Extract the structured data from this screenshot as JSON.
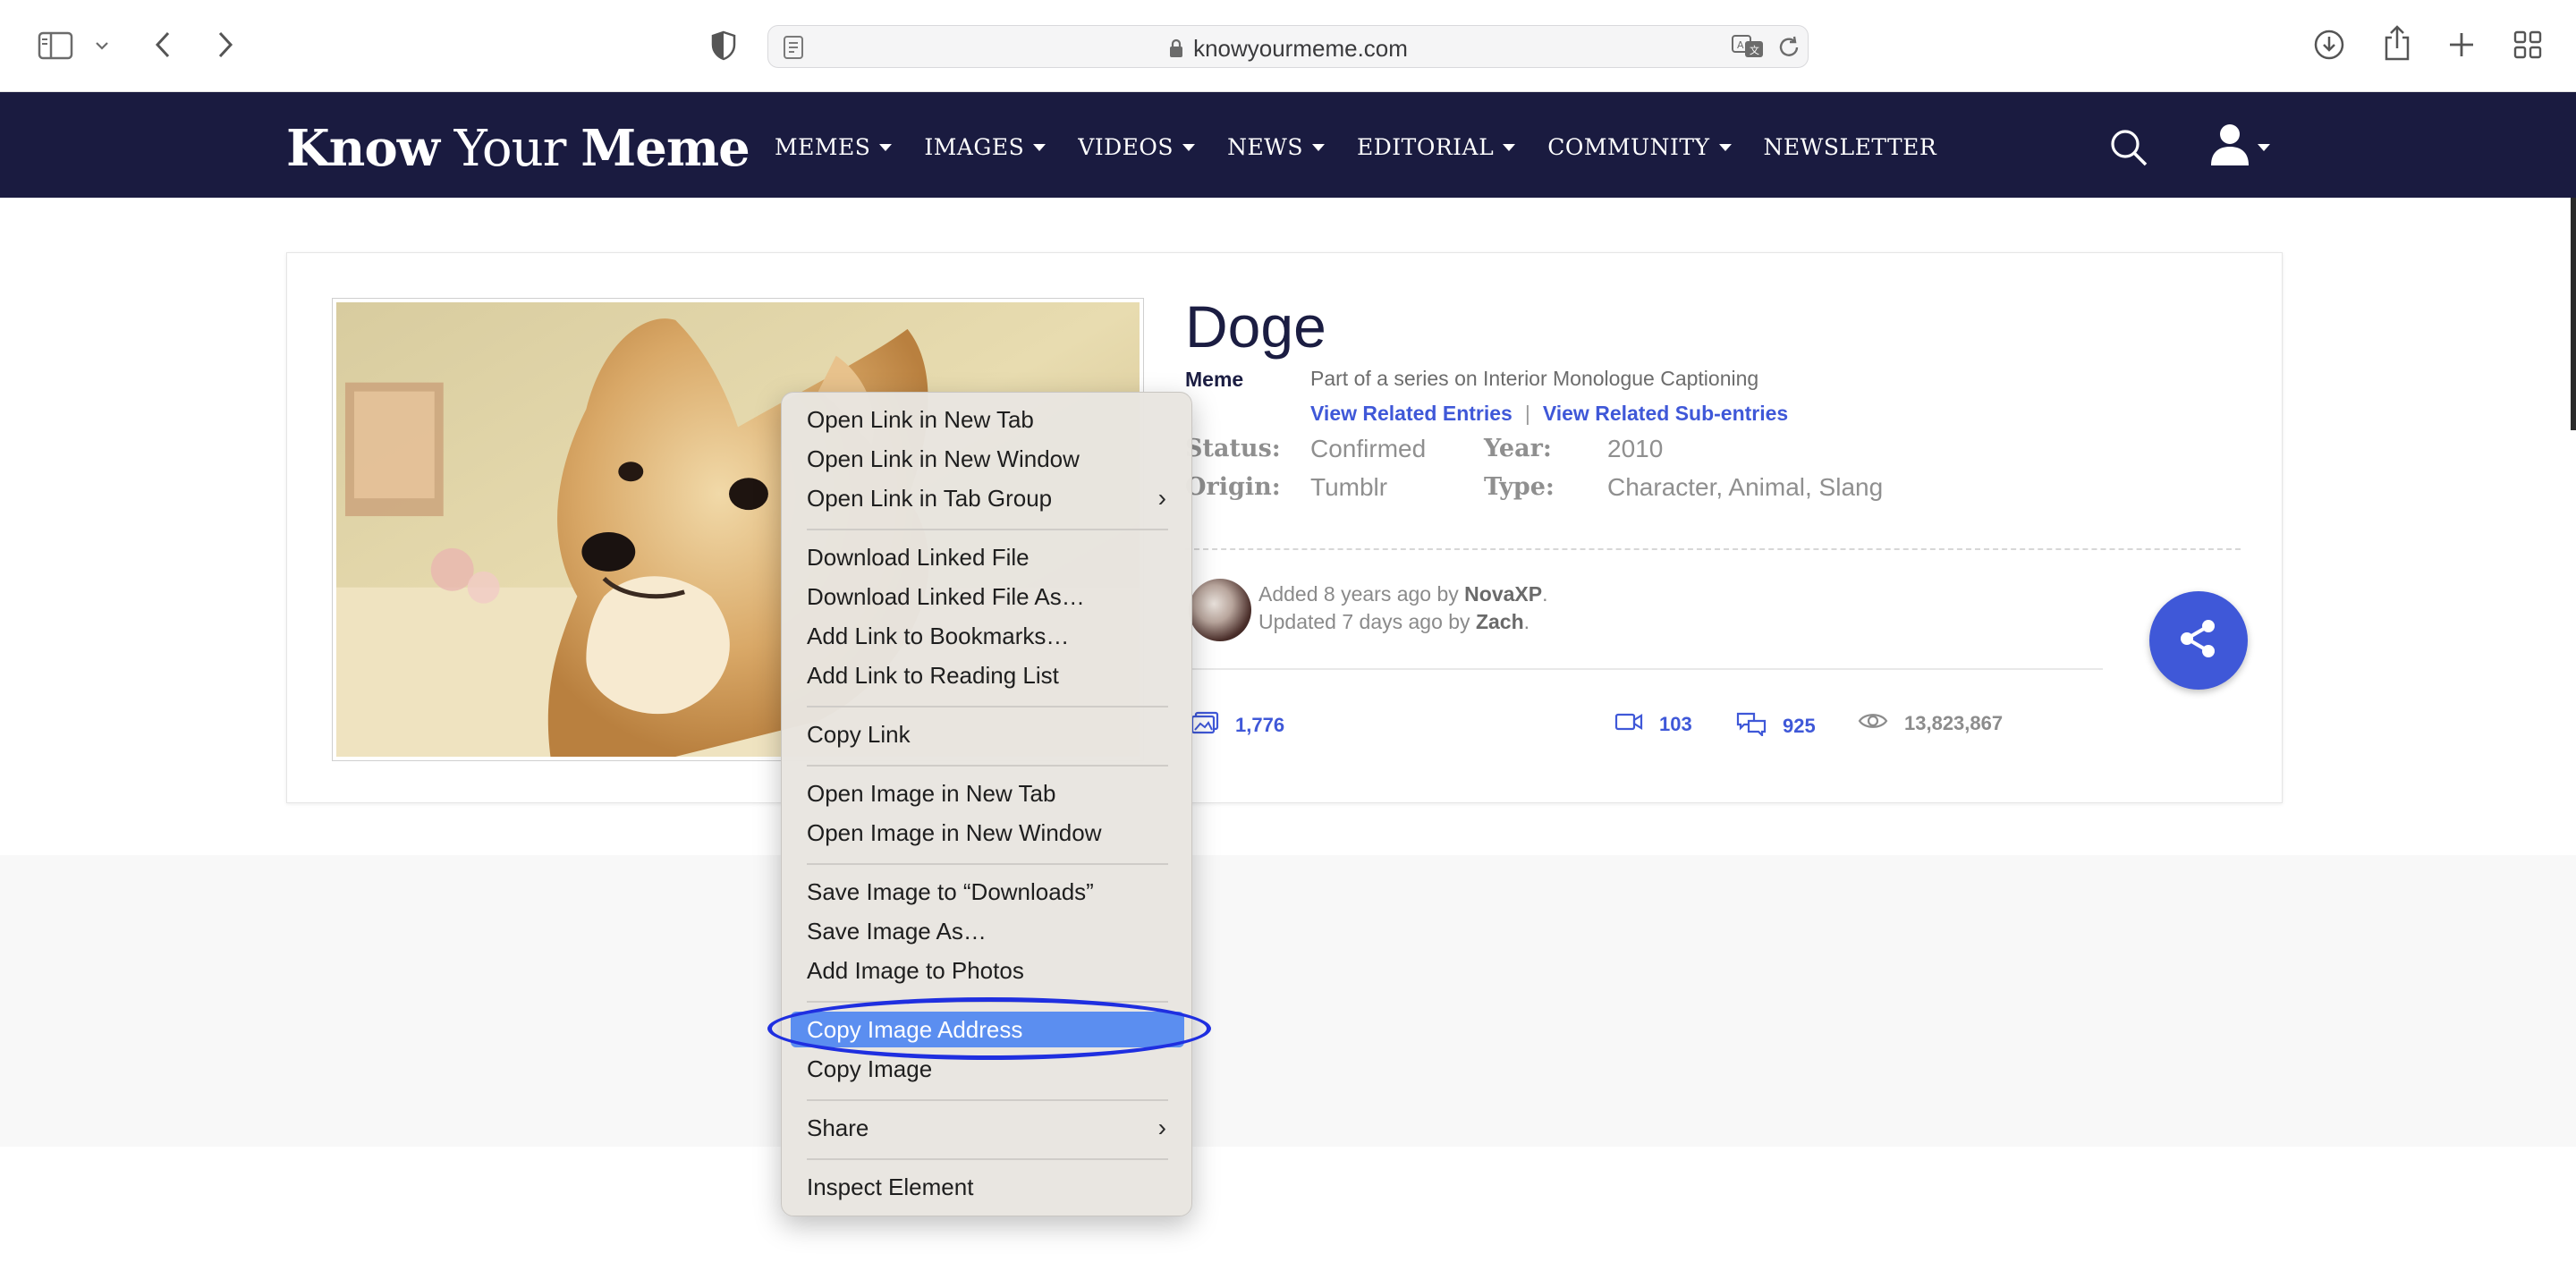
{
  "browser": {
    "url": "knowyourmeme.com"
  },
  "site": {
    "logo_bold1": "Know",
    "logo_light": " Your ",
    "logo_bold2": "Meme",
    "nav": [
      "MEMES",
      "IMAGES",
      "VIDEOS",
      "NEWS",
      "EDITORIAL",
      "COMMUNITY",
      "NEWSLETTER"
    ]
  },
  "entry": {
    "title": "Doge",
    "category": "Meme",
    "series": "Part of a series on Interior Monologue Captioning",
    "related_entries": "View Related Entries",
    "related_separator": "|",
    "related_sub": "View Related Sub-entries",
    "status_label": "Status:",
    "status": "Confirmed",
    "year_label": "Year:",
    "year": "2010",
    "origin_label": "Origin:",
    "origin": "Tumblr",
    "type_label": "Type:",
    "type": "Character, Animal, Slang",
    "added_prefix": "Added 8 years ago by ",
    "added_by": "NovaXP",
    "added_suffix": ".",
    "updated_prefix": "Updated 7 days ago by ",
    "updated_by": "Zach",
    "updated_suffix": ".",
    "stats": {
      "images": "1,776",
      "videos": "103",
      "comments": "925",
      "views": "13,823,867"
    }
  },
  "context_menu": {
    "items": [
      "Open Link in New Tab",
      "Open Link in New Window",
      "Open Link in Tab Group",
      "Download Linked File",
      "Download Linked File As…",
      "Add Link to Bookmarks…",
      "Add Link to Reading List",
      "Copy Link",
      "Open Image in New Tab",
      "Open Image in New Window",
      "Save Image to “Downloads”",
      "Save Image As…",
      "Add Image to Photos",
      "Copy Image Address",
      "Copy Image",
      "Share",
      "Inspect Element"
    ],
    "selected": "Copy Image Address"
  },
  "colors": {
    "nav_bg": "#1a1b40",
    "accent": "#3f58d8",
    "menu_highlight": "#5b8ef0",
    "annotation": "#1f2fe0"
  }
}
